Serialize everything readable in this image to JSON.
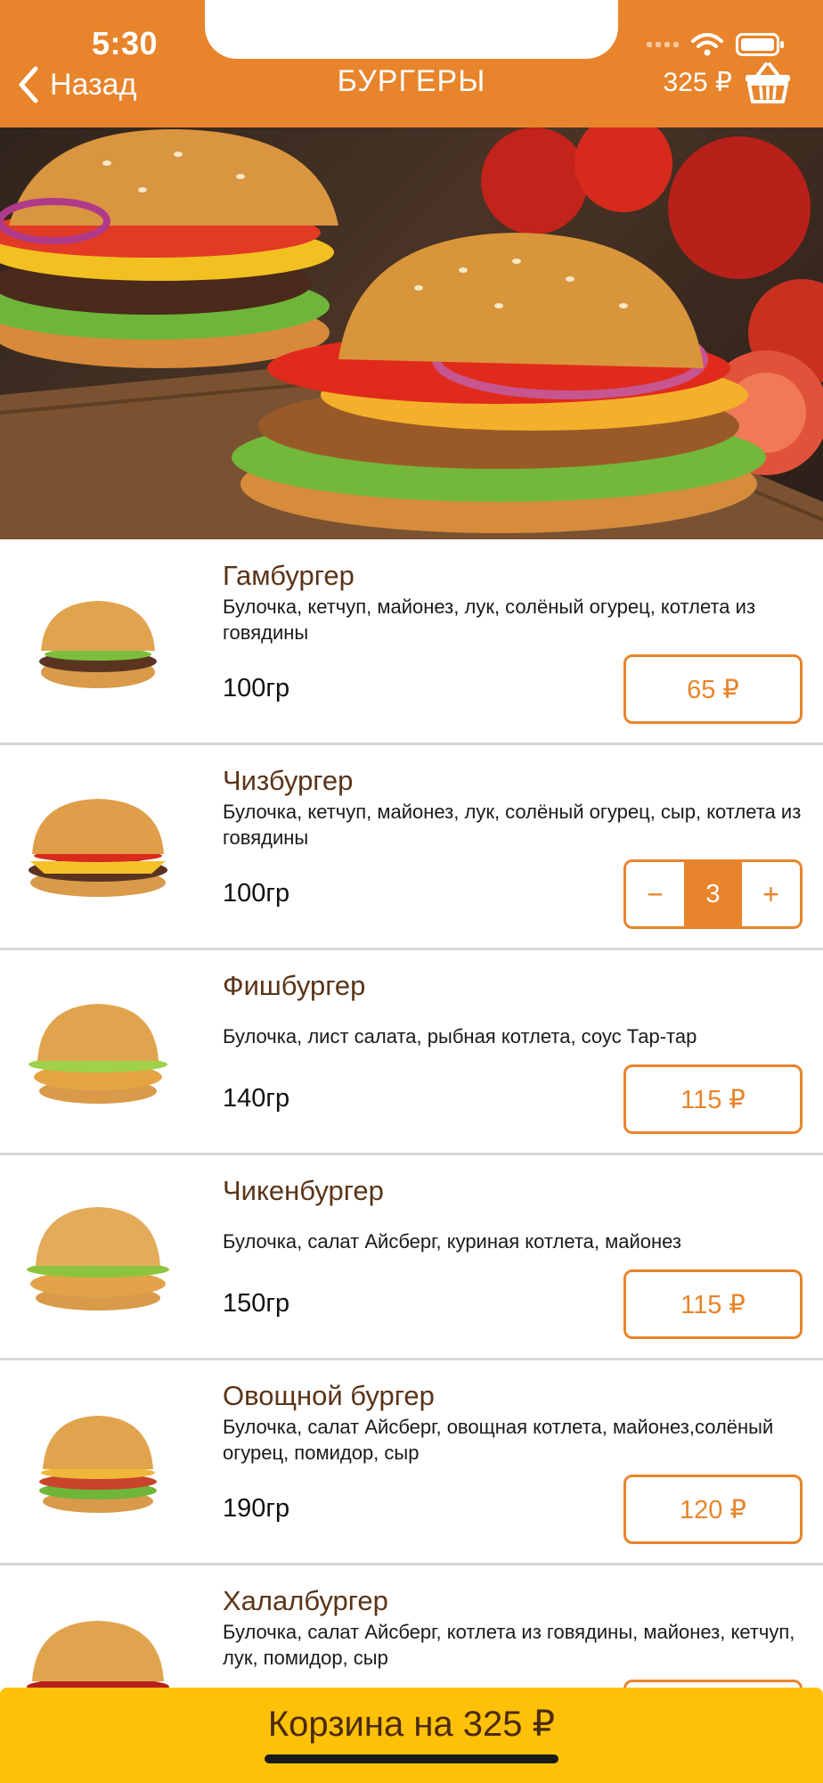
{
  "status_bar": {
    "time": "5:30"
  },
  "header": {
    "back_label": "Назад",
    "title": "БУРГЕРЫ",
    "cart_total": "325 ₽"
  },
  "items": [
    {
      "name": "Гамбургер",
      "description": "Булочка, кетчуп, майонез, лук, солёный огурец, котлета из говядины",
      "weight": "100гр",
      "price": "65 ₽"
    },
    {
      "name": "Чизбургер",
      "description": "Булочка, кетчуп, майонез, лук, солёный огурец, сыр, котлета из говядины",
      "weight": "100гр",
      "quantity": "3",
      "minus": "−",
      "plus": "+"
    },
    {
      "name": "Фишбургер",
      "description": "Булочка, лист салата, рыбная котлета, соус Тар-тар",
      "weight": "140гр",
      "price": "115 ₽"
    },
    {
      "name": "Чикенбургер",
      "description": "Булочка, салат Айсберг, куриная котлета, майонез",
      "weight": "150гр",
      "price": "115 ₽"
    },
    {
      "name": "Овощной бургер",
      "description": "Булочка, салат Айсберг, овощная котлета, майонез,солёный огурец, помидор, сыр",
      "weight": "190гр",
      "price": "120 ₽"
    },
    {
      "name": "Халалбургер",
      "description": "Булочка, салат Айсберг, котлета из говядины, майонез, кетчуп, лук, помидор, сыр",
      "weight": "",
      "price": ""
    }
  ],
  "cart_bar": {
    "label": "Корзина на 325 ₽"
  },
  "colors": {
    "accent": "#E8842B",
    "cart_bar": "#FFC107",
    "title_brown": "#5a3418"
  }
}
